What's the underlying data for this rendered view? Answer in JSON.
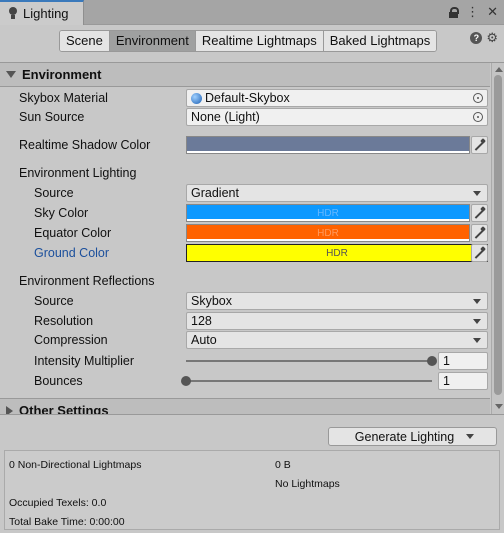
{
  "window": {
    "tab_title": "Lighting"
  },
  "toolbar": {
    "tabs": [
      {
        "label": "Scene",
        "active": false
      },
      {
        "label": "Environment",
        "active": true
      },
      {
        "label": "Realtime Lightmaps",
        "active": false
      },
      {
        "label": "Baked Lightmaps",
        "active": false
      }
    ]
  },
  "environment": {
    "header": "Environment",
    "skybox_material": {
      "label": "Skybox Material",
      "value": "Default-Skybox"
    },
    "sun_source": {
      "label": "Sun Source",
      "value": "None (Light)"
    },
    "realtime_shadow_color": {
      "label": "Realtime Shadow Color",
      "color": "#6b7a99"
    },
    "lighting": {
      "header": "Environment Lighting",
      "source": {
        "label": "Source",
        "value": "Gradient"
      },
      "sky_color": {
        "label": "Sky Color",
        "color": "#0d99ff",
        "badge": "HDR"
      },
      "equator_color": {
        "label": "Equator Color",
        "color": "#ff6200",
        "badge": "HDR"
      },
      "ground_color": {
        "label": "Ground Color",
        "color": "#ffff00",
        "badge": "HDR"
      }
    },
    "reflections": {
      "header": "Environment Reflections",
      "source": {
        "label": "Source",
        "value": "Skybox"
      },
      "resolution": {
        "label": "Resolution",
        "value": "128"
      },
      "compression": {
        "label": "Compression",
        "value": "Auto"
      },
      "intensity_multiplier": {
        "label": "Intensity Multiplier",
        "value": "1",
        "slider_fraction": 1.0
      },
      "bounces": {
        "label": "Bounces",
        "value": "1",
        "slider_fraction": 0.0
      }
    }
  },
  "other_settings": {
    "header": "Other Settings"
  },
  "generate": {
    "label": "Generate Lighting"
  },
  "stats": {
    "non_directional": "0 Non-Directional Lightmaps",
    "size": "0 B",
    "no_lightmaps": "No Lightmaps",
    "occupied_texels": "Occupied Texels: 0.0",
    "total_bake_time": "Total Bake Time: 0:00:00"
  }
}
